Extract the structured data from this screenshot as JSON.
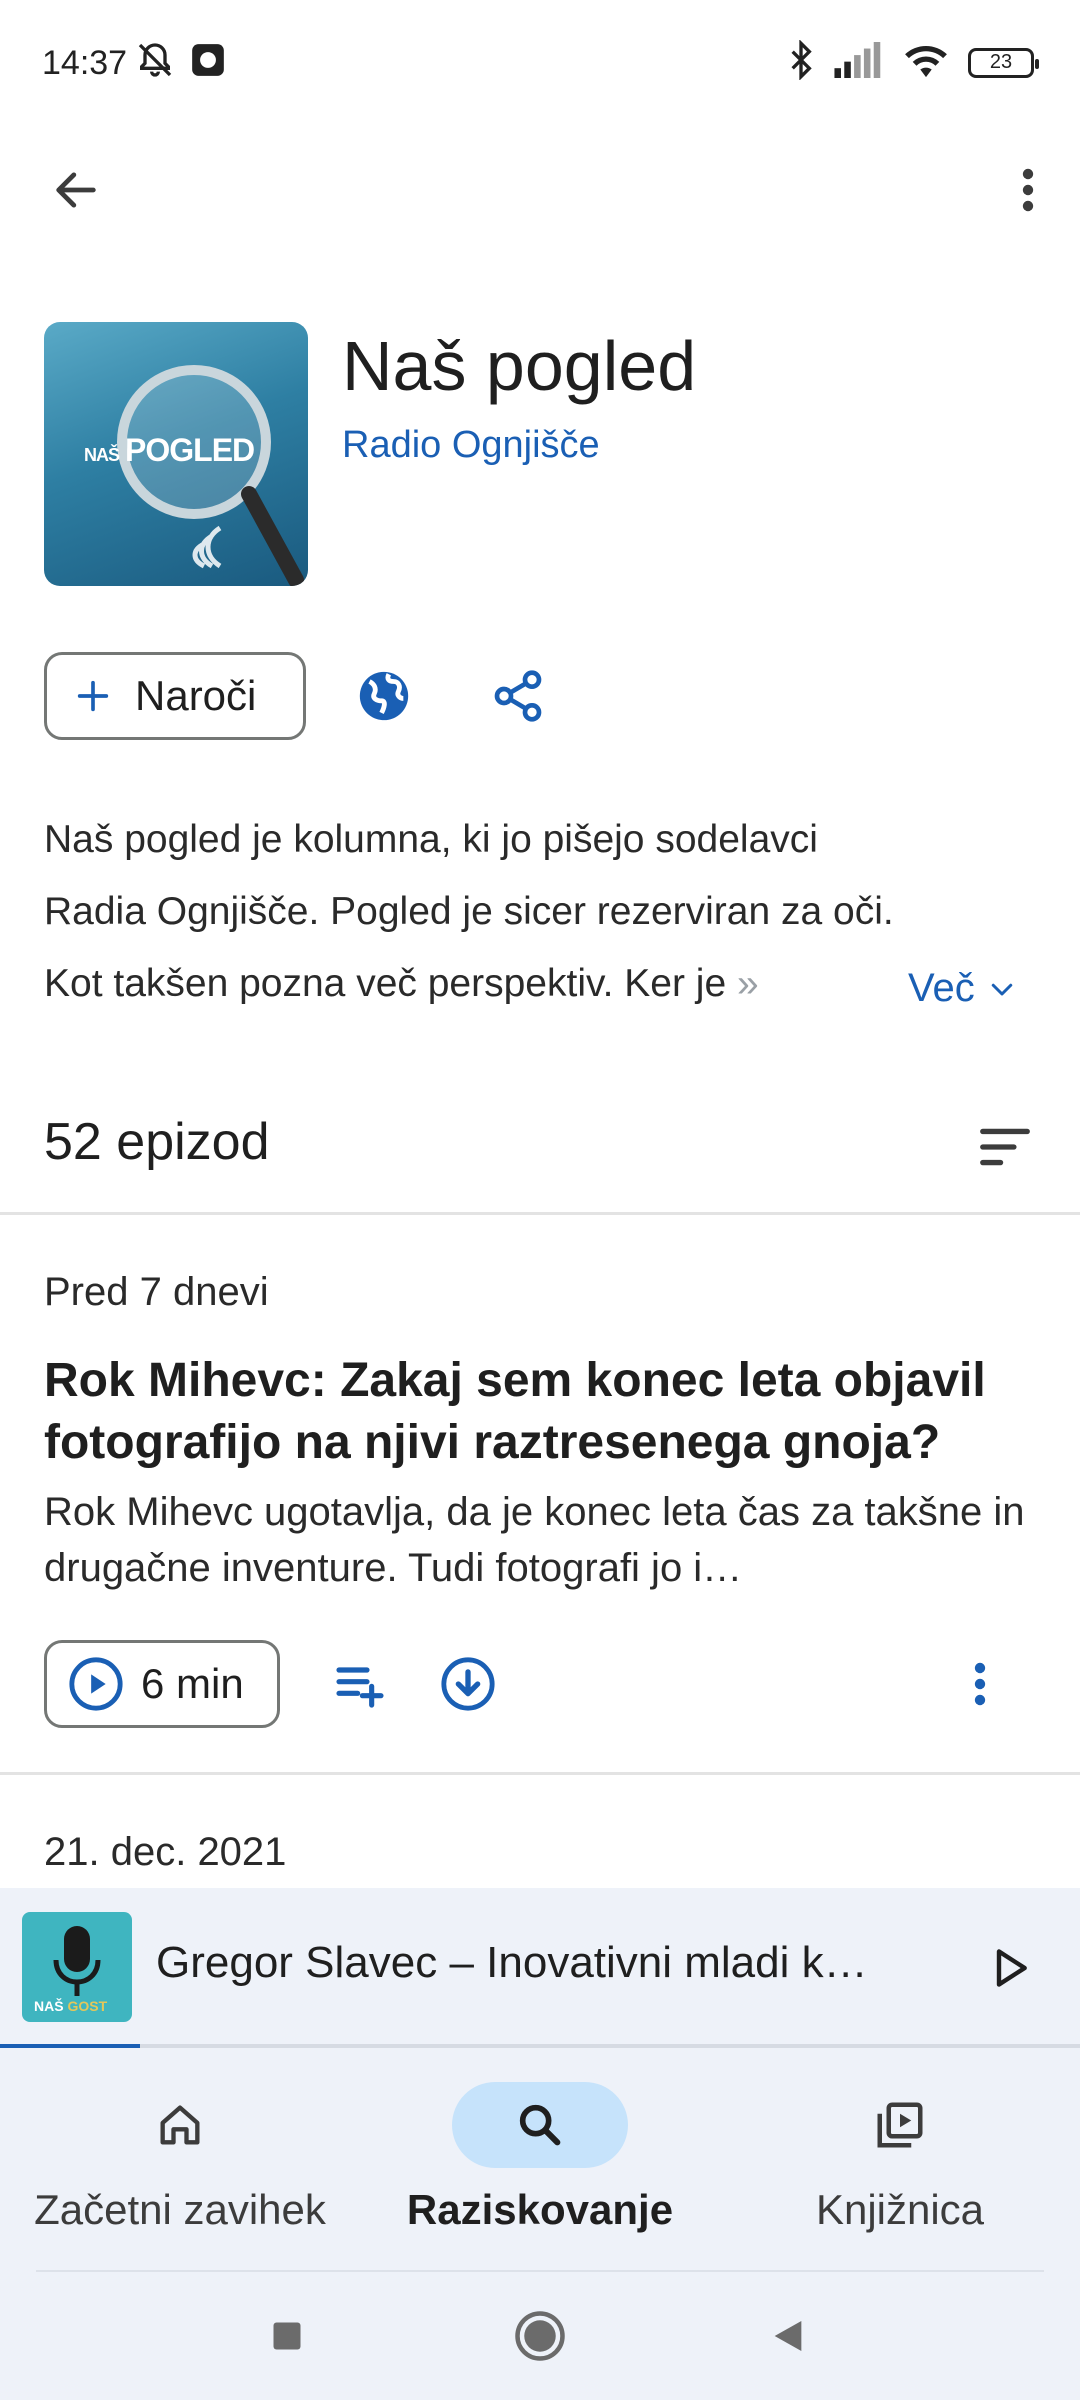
{
  "status_bar": {
    "time": "14:37",
    "battery": "23"
  },
  "podcast": {
    "title": "Naš pogled",
    "author": "Radio Ognjišče",
    "cover_text_small": "NAŠ",
    "cover_text_big": "POGLED",
    "subscribe_label": "Naroči",
    "description_lines": [
      "Naš pogled je kolumna, ki jo pišejo sodelavci",
      "Radia Ognjišče. Pogled je sicer rezerviran za oči.",
      "Kot takšen pozna več perspektiv. Ker je"
    ],
    "description_fade": "»",
    "more_label": "Več"
  },
  "episodes": {
    "count_label": "52 epizod",
    "items": [
      {
        "date": "Pred 7 dnevi",
        "title": "Rok Mihevc: Zakaj sem konec leta objavil fotografijo na njivi raztresenega gnoja?",
        "description": "Rok Mihevc ugotavlja, da je konec leta čas za takšne in drugačne inventure. Tudi fotografi jo i…",
        "duration": "6 min"
      },
      {
        "date": "21. dec. 2021"
      }
    ]
  },
  "mini_player": {
    "title": "Gregor Slavec – Inovativni mladi k…",
    "thumb_text_a": "NAŠ",
    "thumb_text_b": "GOST",
    "progress": 0.13
  },
  "bottom_nav": {
    "items": [
      {
        "label": "Začetni zavihek",
        "icon": "home-icon",
        "active": false
      },
      {
        "label": "Raziskovanje",
        "icon": "search-icon",
        "active": true
      },
      {
        "label": "Knjižnica",
        "icon": "library-icon",
        "active": false
      }
    ]
  },
  "colors": {
    "accent": "#1a5fb4",
    "nav_active_bg": "#c6e3fb",
    "surface": "#eef2f9"
  }
}
